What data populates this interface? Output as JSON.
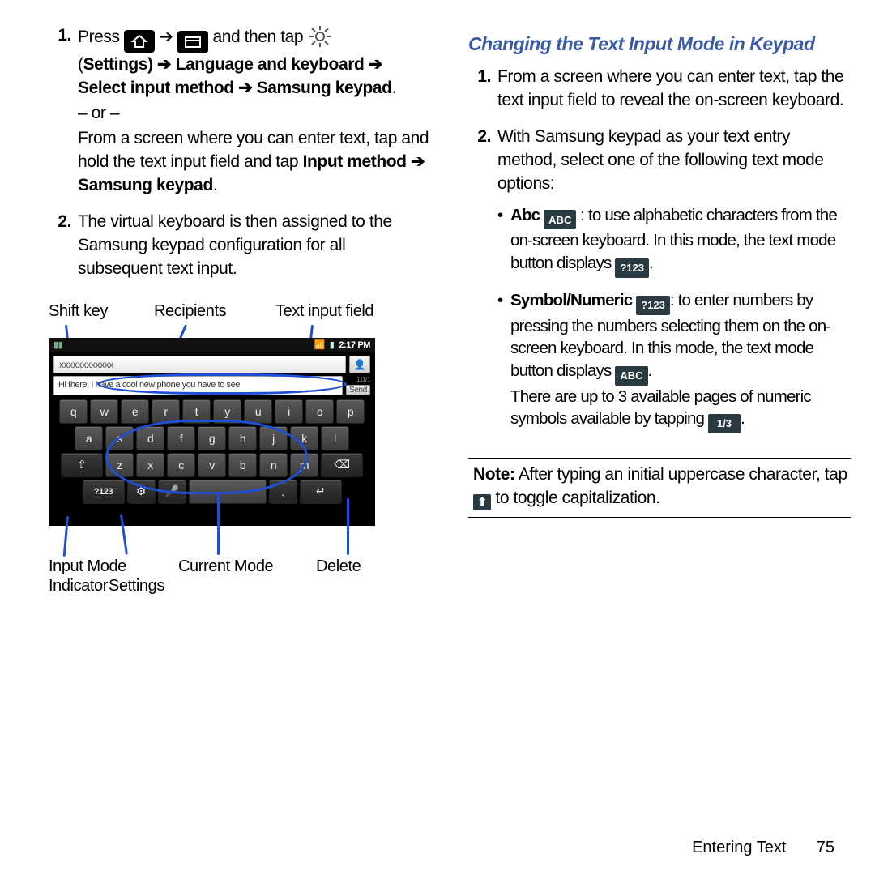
{
  "left": {
    "step1": {
      "press": "Press ",
      "and_then_tap": " and then tap ",
      "settings_open": "(",
      "settings": "Settings",
      "path_rest1": ") ➔ Language and keyboard ➔ Select input method ➔ Samsung keypad",
      "or": "– or –",
      "p2": "From a screen where you can enter text, tap and hold the text input field and tap ",
      "input_method": "Input method ➔ Samsung keypad",
      "period": "."
    },
    "step2": "The virtual keyboard is then assigned to the Samsung keypad configuration for all subsequent text input.",
    "labels": {
      "shift": "Shift key",
      "recip": "Recipients",
      "tif": "Text input field",
      "imi": "Input Mode\nIndicator",
      "settings": "Settings",
      "current": "Current Mode",
      "delete": "Delete"
    },
    "kb": {
      "time": "2:17 PM",
      "recipient_value": "xxxxxxxxxxxx",
      "msg_value": "Hi there, I have a cool new phone you have to see",
      "send": "Send",
      "mode_key": "?123",
      "rows": [
        [
          "q",
          "w",
          "e",
          "r",
          "t",
          "y",
          "u",
          "i",
          "o",
          "p"
        ],
        [
          "a",
          "s",
          "d",
          "f",
          "g",
          "h",
          "j",
          "k",
          "l"
        ],
        [
          "↑",
          "z",
          "x",
          "c",
          "v",
          "b",
          "n",
          "m",
          "⌫"
        ],
        [
          "?123",
          "⚙",
          "🎤",
          " ",
          ".",
          "↵"
        ]
      ]
    }
  },
  "right": {
    "heading": "Changing the Text Input Mode in Keypad",
    "step1": "From a screen where you can enter text, tap the text input field to reveal the on-screen keyboard.",
    "step2_lead": "With Samsung keypad as your text entry method, select one of the following text mode options:",
    "bullet_abc": {
      "lead_bold": "Abc",
      "chip": "ABC",
      "text1": ": to use alphabetic characters from the on-screen keyboard. In this mode, the text mode button displays ",
      "chip2": "?123",
      "tail": "."
    },
    "bullet_sym": {
      "lead_bold": "Symbol/Numeric",
      "chip": "?123",
      "text1": ": to enter numbers by pressing the numbers selecting them on the on-screen keyboard. In this mode, the text mode button displays ",
      "chip2": "ABC",
      "tail": ".",
      "text2a": "There are up to 3 available pages of numeric symbols available by tapping ",
      "chip3": "1/3",
      "text2b": "."
    },
    "note_lead": "Note:",
    "note_text1": " After typing an initial uppercase character, tap ",
    "note_text2": " to toggle capitalization."
  },
  "footer": {
    "section": "Entering Text",
    "page": "75"
  }
}
